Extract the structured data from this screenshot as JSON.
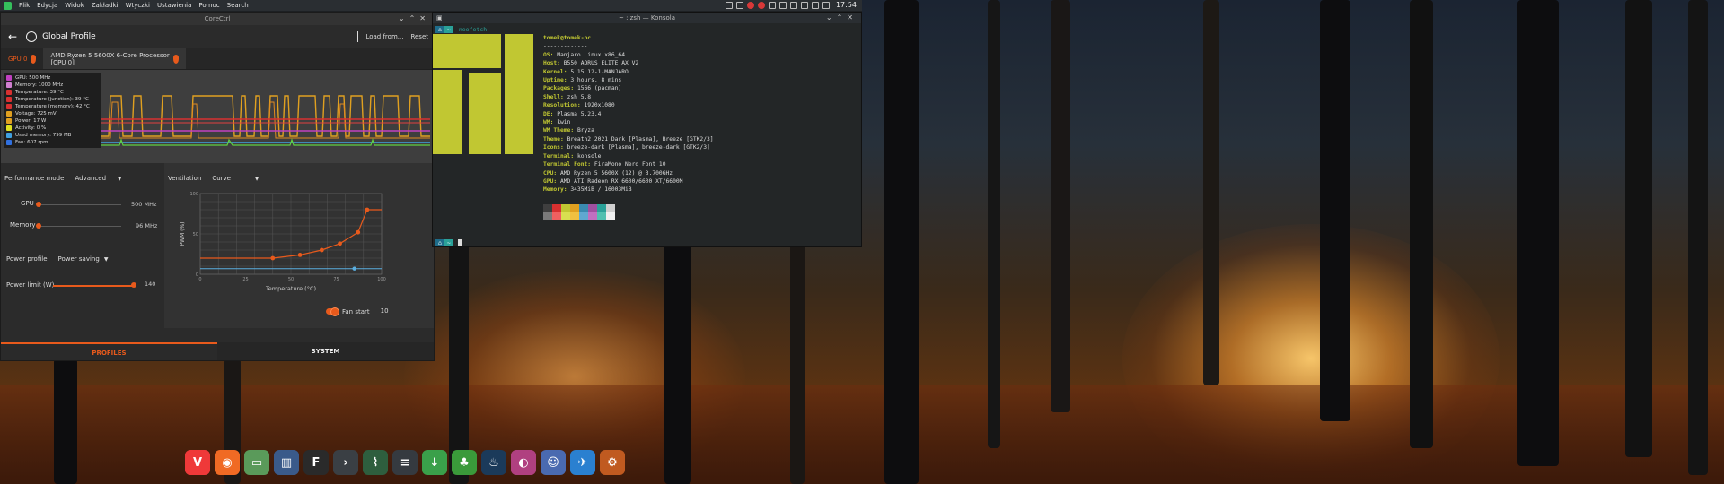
{
  "topbar": {
    "menu": [
      "Plik",
      "Edycja",
      "Widok",
      "Zakładki",
      "Wtyczki",
      "Ustawienia",
      "Pomoc",
      "Search"
    ],
    "clock": "17:54"
  },
  "corectrl": {
    "window_title": "CoreCtrl",
    "profile_name": "Global Profile",
    "load_from": "Load from...",
    "reset": "Reset",
    "gpu_tab": "GPU 0",
    "cpu_tab_line1": "AMD Ryzen 5 5600X 6-Core Processor",
    "cpu_tab_line2": "[CPU 0]",
    "legend": [
      {
        "label": "GPU: 500 MHz",
        "color": "#c040c0"
      },
      {
        "label": "Memory: 1000 MHz",
        "color": "#d080d0"
      },
      {
        "label": "Temperature: 39 °C",
        "color": "#d83030"
      },
      {
        "label": "Temperature (junction): 39 °C",
        "color": "#d83030"
      },
      {
        "label": "Temperature (memory): 42 °C",
        "color": "#d83030"
      },
      {
        "label": "Voltage: 725 mV",
        "color": "#e0a020"
      },
      {
        "label": "Power: 17 W",
        "color": "#e0a020"
      },
      {
        "label": "Activity: 0 %",
        "color": "#e0e020"
      },
      {
        "label": "Used memory: 799 MB",
        "color": "#40a0e0"
      },
      {
        "label": "Fan: 607 rpm",
        "color": "#3070e0"
      }
    ],
    "performance_mode_label": "Performance mode",
    "performance_mode_value": "Advanced",
    "gpu_label": "GPU",
    "gpu_value": "500 MHz",
    "gpu_level": 0.0,
    "memory_label": "Memory",
    "memory_value": "96 MHz",
    "memory_level": 0.0,
    "power_profile_label": "Power profile",
    "power_profile_value": "Power saving",
    "power_limit_label": "Power limit (W)",
    "power_limit_value": "140",
    "power_limit_level": 1.0,
    "ventilation_label": "Ventilation",
    "ventilation_value": "Curve",
    "fan_curve": {
      "ylabel": "PWM (%)",
      "xlabel": "Temperature (°C)",
      "y_ticks": [
        "100",
        "50",
        "0"
      ],
      "x_ticks": [
        "0",
        "25",
        "50",
        "75",
        "100"
      ],
      "points": [
        [
          0,
          20
        ],
        [
          40,
          20
        ],
        [
          55,
          24
        ],
        [
          67,
          30
        ],
        [
          77,
          38
        ],
        [
          87,
          52
        ],
        [
          92,
          80
        ],
        [
          100,
          80
        ]
      ],
      "current": [
        85,
        7
      ]
    },
    "fan_start_label": "Fan start",
    "fan_start_value": "10",
    "tab_profiles": "PROFILES",
    "tab_system": "SYSTEM"
  },
  "konsole": {
    "title": "~ : zsh — Konsola",
    "prompt_icon": "⌂",
    "prompt_arrow": "~",
    "command": "neofetch",
    "user_host": "tomek@tomek-pc",
    "separator": "-------------",
    "info": [
      {
        "key": "OS",
        "value": "Manjaro Linux x86_64"
      },
      {
        "key": "Host",
        "value": "B550 AORUS ELITE AX V2"
      },
      {
        "key": "Kernel",
        "value": "5.15.12-1-MANJARO"
      },
      {
        "key": "Uptime",
        "value": "3 hours, 8 mins"
      },
      {
        "key": "Packages",
        "value": "1566 (pacman)"
      },
      {
        "key": "Shell",
        "value": "zsh 5.8"
      },
      {
        "key": "Resolution",
        "value": "1920x1080"
      },
      {
        "key": "DE",
        "value": "Plasma 5.23.4"
      },
      {
        "key": "WM",
        "value": "kwin"
      },
      {
        "key": "WM Theme",
        "value": "Bryza"
      },
      {
        "key": "Theme",
        "value": "Breath2 2021 Dark [Plasma], Breeze [GTK2/3]"
      },
      {
        "key": "Icons",
        "value": "breeze-dark [Plasma], breeze-dark [GTK2/3]"
      },
      {
        "key": "Terminal",
        "value": "konsole"
      },
      {
        "key": "Terminal Font",
        "value": "FiraMono Nerd Font 10"
      },
      {
        "key": "CPU",
        "value": "AMD Ryzen 5 5600X (12) @ 3.700GHz"
      },
      {
        "key": "GPU",
        "value": "AMD ATI Radeon RX 6600/6600 XT/6600M"
      },
      {
        "key": "Memory",
        "value": "3435MiB / 16003MiB"
      }
    ],
    "palette": [
      "#3f3f3f",
      "#d83030",
      "#c1c732",
      "#e0a020",
      "#3a8ab0",
      "#a050a0",
      "#2aa198",
      "#cfcfcf",
      "#7a7a7a",
      "#f06060",
      "#d8df50",
      "#f0c040",
      "#60a8d0",
      "#c070c0",
      "#50c0b0",
      "#f0f0f0"
    ]
  },
  "dock": [
    {
      "icon": "vivaldi-icon",
      "glyph": "V",
      "color": "#ef3939"
    },
    {
      "icon": "firefox-icon",
      "glyph": "◉",
      "color": "#f06a24"
    },
    {
      "icon": "files-icon",
      "glyph": "▭",
      "color": "#5a9a5a"
    },
    {
      "icon": "library-icon",
      "glyph": "▥",
      "color": "#3a5a8a"
    },
    {
      "icon": "fonts-icon",
      "glyph": "F",
      "color": "#2a2a2a"
    },
    {
      "icon": "terminal-icon",
      "glyph": "›",
      "color": "#3a3f44"
    },
    {
      "icon": "system-monitor-icon",
      "glyph": "⌇",
      "color": "#2e5e3e"
    },
    {
      "icon": "settings-icon",
      "glyph": "≡",
      "color": "#353a40"
    },
    {
      "icon": "download-icon",
      "glyph": "↓",
      "color": "#3aa04a"
    },
    {
      "icon": "leaf-icon",
      "glyph": "♣",
      "color": "#3a9a3a"
    },
    {
      "icon": "steam-icon",
      "glyph": "♨",
      "color": "#1b3a5a"
    },
    {
      "icon": "color-icon",
      "glyph": "◐",
      "color": "#b04080"
    },
    {
      "icon": "game-icon",
      "glyph": "☺",
      "color": "#4a6ab0"
    },
    {
      "icon": "plane-icon",
      "glyph": "✈",
      "color": "#2a80d0"
    },
    {
      "icon": "corectrl-icon",
      "glyph": "⚙",
      "color": "#c05a20"
    }
  ]
}
